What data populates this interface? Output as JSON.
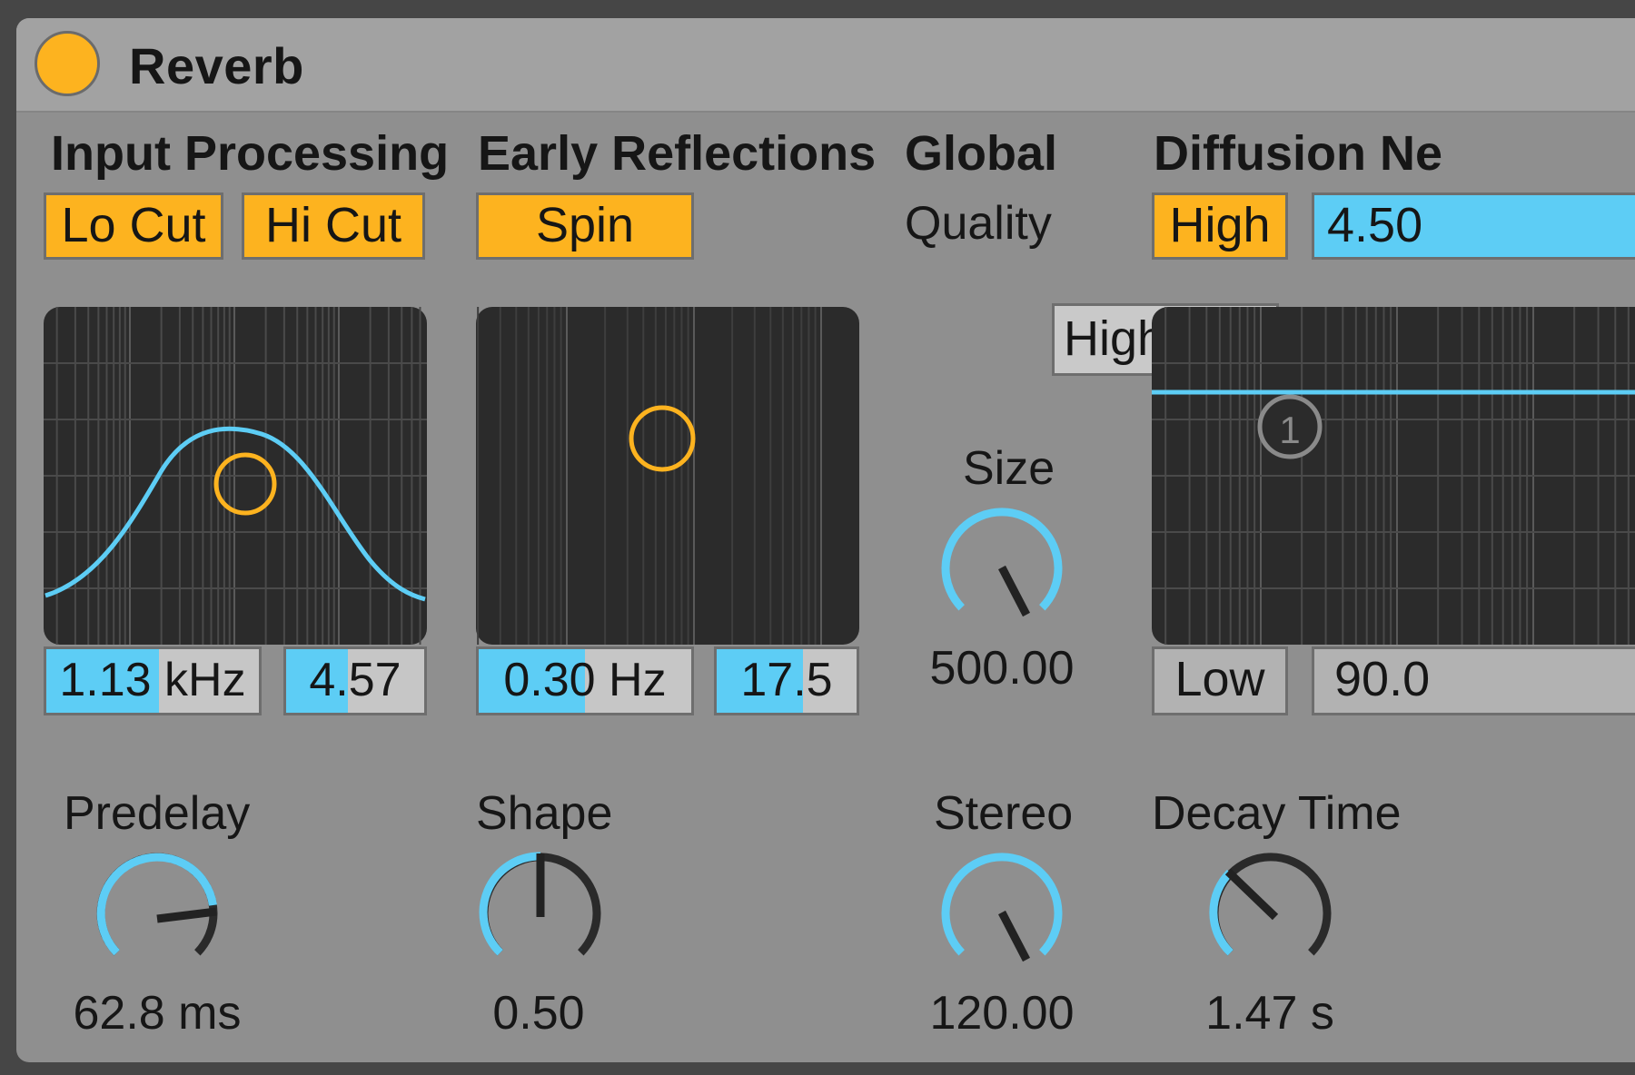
{
  "device": {
    "title": "Reverb",
    "power_on": true
  },
  "input_processing": {
    "heading": "Input Processing",
    "lo_cut_label": "Lo Cut",
    "hi_cut_label": "Hi Cut",
    "freq_value": "1.13",
    "freq_unit": "kHz",
    "freq_fill": 0.55,
    "width_value": "4.57",
    "width_fill": 0.45
  },
  "early_reflections": {
    "heading": "Early Reflections",
    "spin_label": "Spin",
    "rate_value": "0.30",
    "rate_unit": "Hz",
    "rate_fill": 0.5,
    "amount_value": "17.5",
    "amount_fill": 0.6
  },
  "global": {
    "heading": "Global",
    "quality_label": "Quality",
    "quality_value": "High",
    "size_label": "Size",
    "size_value": "500.00",
    "stereo_label": "Stereo",
    "stereo_value": "120.00"
  },
  "diffusion": {
    "heading": "Diffusion Ne",
    "high_label": "High",
    "high_value": "4.50",
    "low_label": "Low",
    "low_value": "90.0",
    "node_label": "1"
  },
  "knobs": {
    "predelay_label": "Predelay",
    "predelay_value": "62.8 ms",
    "shape_label": "Shape",
    "shape_value": "0.50",
    "decay_label": "Decay Time",
    "decay_value": "1.47 s"
  },
  "colors": {
    "accent_orange": "#fdb31f",
    "accent_blue": "#5dcdf5",
    "panel": "#8f8f8f",
    "display_bg": "#2b2b2b"
  }
}
